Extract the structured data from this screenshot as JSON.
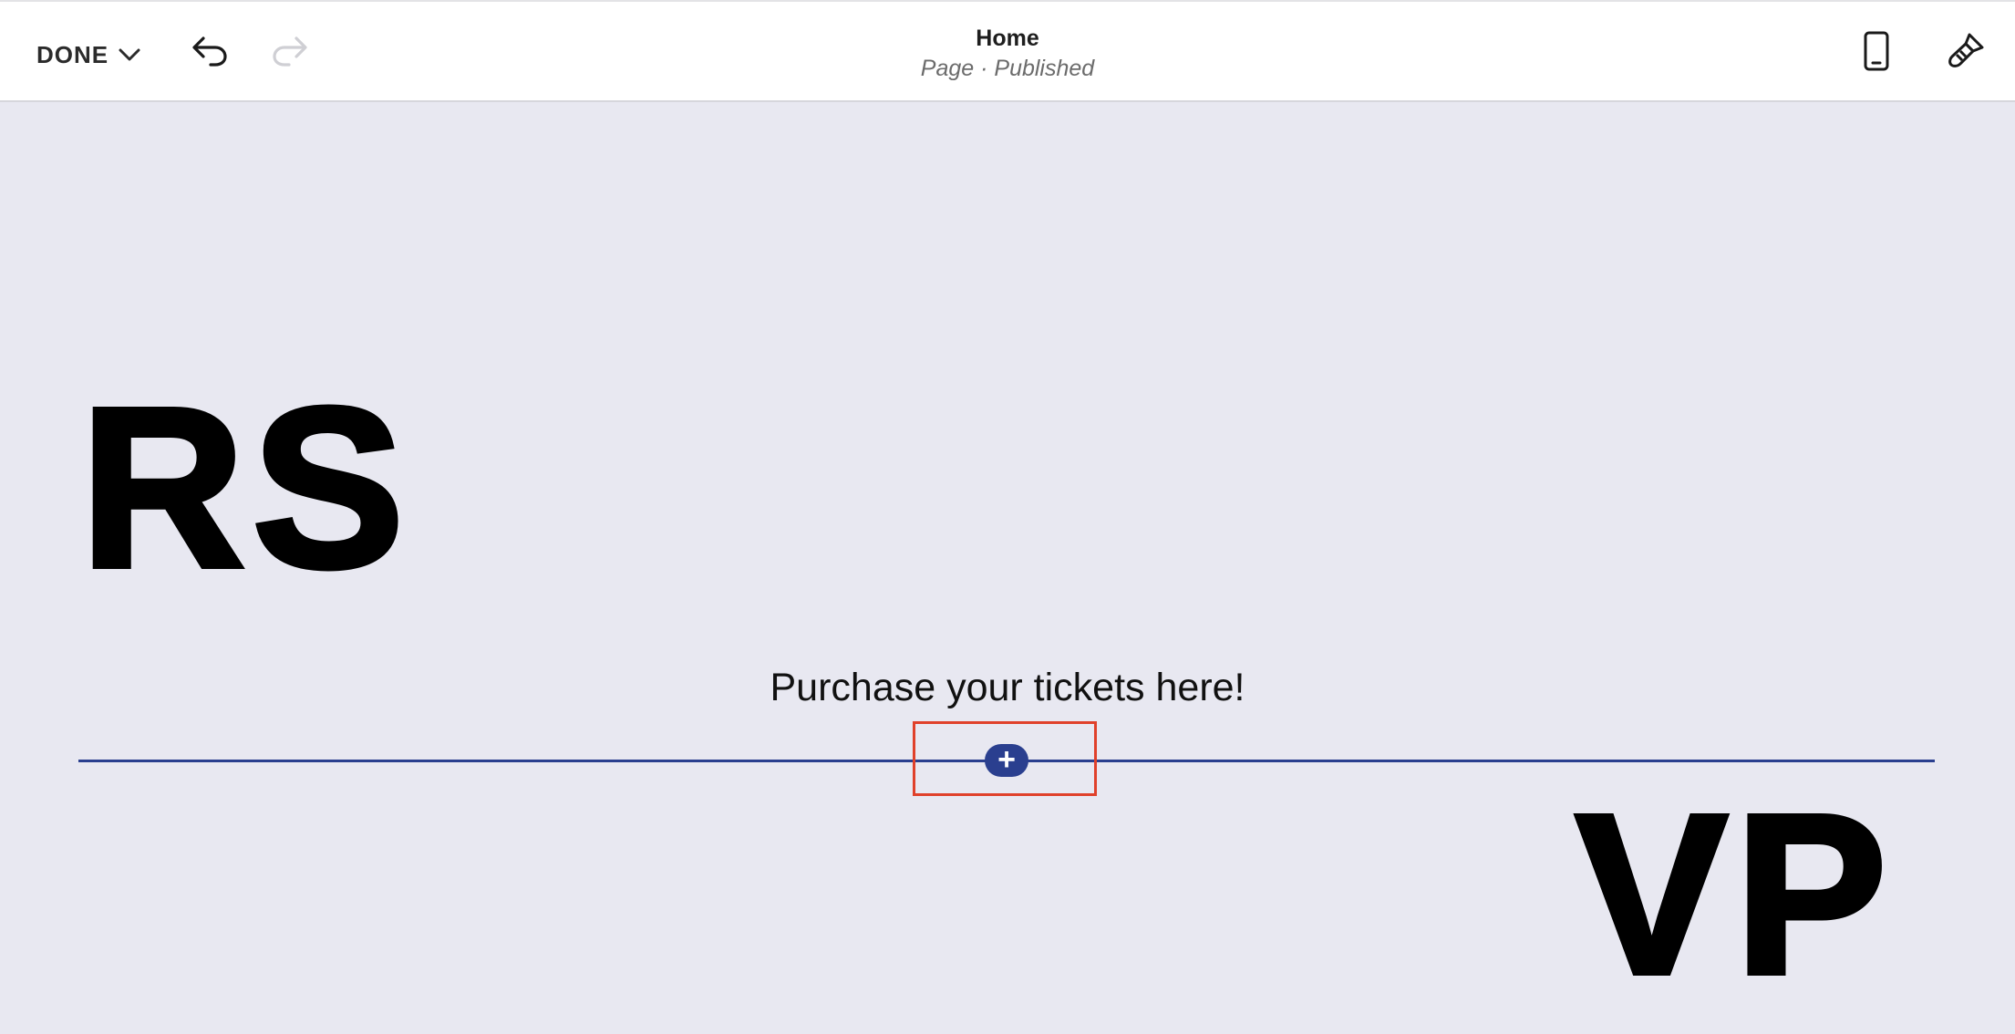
{
  "toolbar": {
    "done_label": "DONE",
    "title": "Home",
    "status": "Page · Published",
    "icons": {
      "chevron": "chevron-down-icon",
      "undo": "undo-icon",
      "redo": "redo-icon",
      "mobile": "mobile-preview-icon",
      "design": "paintbrush-icon"
    }
  },
  "canvas": {
    "left_heading": "RS",
    "right_heading": "VP",
    "tagline": "Purchase your tickets here!",
    "add_section_symbol": "+"
  },
  "colors": {
    "canvas_bg": "#e8e8f1",
    "accent": "#2a3f8f",
    "highlight": "#e0412b",
    "redo_disabled": "#cfcfd4"
  }
}
